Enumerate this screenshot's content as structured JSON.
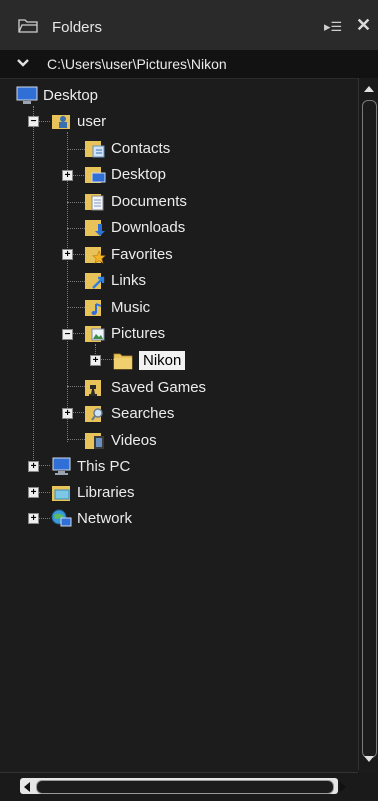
{
  "header": {
    "title": "Folders",
    "folder_icon": "folder-outline-icon",
    "pin_icon": "pin-panel-icon",
    "close_icon": "close-icon"
  },
  "pathbar": {
    "path": "C:\\Users\\user\\Pictures\\Nikon",
    "toggle_icon": "chevron-down-icon"
  },
  "tree": {
    "desktop": "Desktop",
    "user": "user",
    "contacts": "Contacts",
    "desktop2": "Desktop",
    "documents": "Documents",
    "downloads": "Downloads",
    "favorites": "Favorites",
    "links": "Links",
    "music": "Music",
    "pictures": "Pictures",
    "nikon": "Nikon",
    "saved_games": "Saved Games",
    "searches": "Searches",
    "videos": "Videos",
    "this_pc": "This PC",
    "libraries": "Libraries",
    "network": "Network"
  },
  "selected": "Nikon",
  "colors": {
    "background": "#1c1c1c",
    "header": "#2a2a2a",
    "selection": "#f2f2f2",
    "folder": "#e8c35a"
  }
}
